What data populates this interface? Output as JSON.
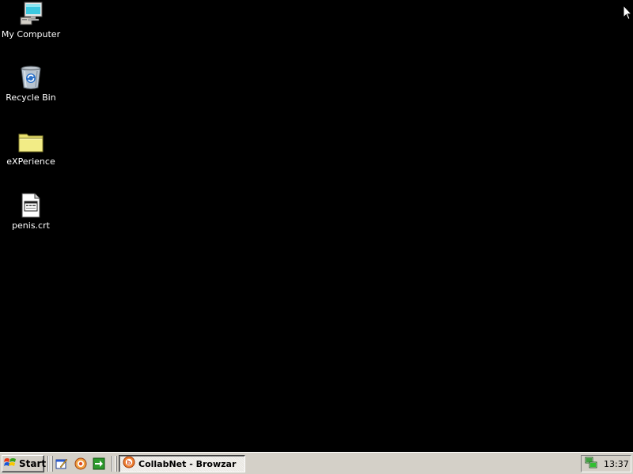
{
  "desktop": {
    "background": "#000000",
    "icons": [
      {
        "label": "My Computer",
        "icon": "my-computer-icon"
      },
      {
        "label": "Recycle Bin",
        "icon": "recycle-bin-icon"
      },
      {
        "label": "eXPerience",
        "icon": "folder-icon"
      },
      {
        "label": "penis.crt",
        "icon": "certificate-file-icon"
      }
    ]
  },
  "taskbar": {
    "start_label": "Start",
    "quick_launch": [
      {
        "icon": "show-desktop-icon"
      },
      {
        "icon": "browser-icon"
      },
      {
        "icon": "green-arrow-icon"
      }
    ],
    "tasks": [
      {
        "label": "CollabNet - Browzar",
        "icon": "browzar-icon",
        "active": true
      }
    ],
    "tray": {
      "icon": "network-icon",
      "clock": "13:37"
    }
  },
  "colors": {
    "taskbar": "#d4d0c8",
    "desktop": "#000000",
    "label_text": "#ffffff"
  }
}
